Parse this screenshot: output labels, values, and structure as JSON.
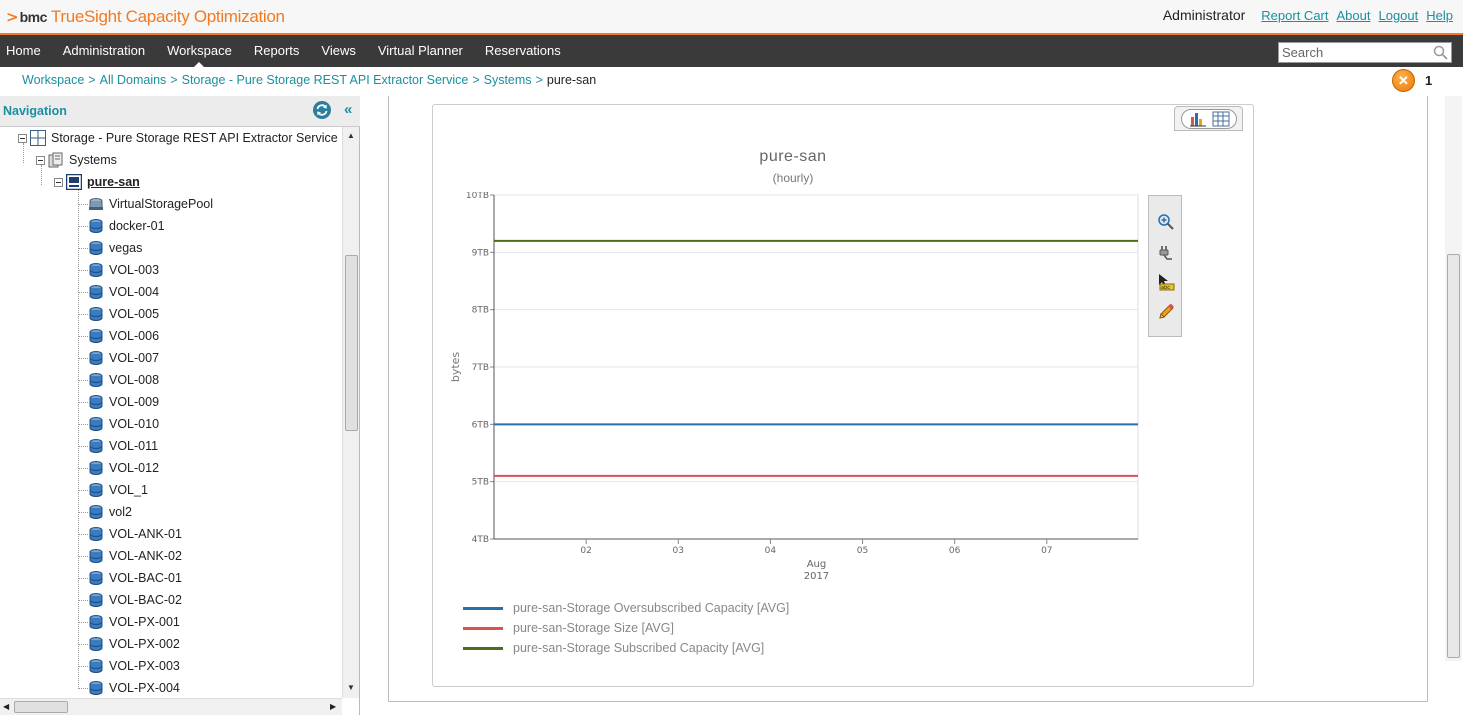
{
  "app": {
    "brand": "bmc",
    "product": "TrueSight Capacity Optimization"
  },
  "header": {
    "user": "Administrator",
    "links": [
      "Report Cart",
      "About",
      "Logout",
      "Help"
    ]
  },
  "menu": {
    "items": [
      "Home",
      "Administration",
      "Workspace",
      "Reports",
      "Views",
      "Virtual Planner",
      "Reservations"
    ],
    "active": "Workspace"
  },
  "search": {
    "placeholder": "Search"
  },
  "breadcrumb": {
    "items": [
      "Workspace",
      "All Domains",
      "Storage - Pure Storage REST API Extractor Service",
      "Systems"
    ],
    "current": "pure-san"
  },
  "alerts": {
    "count": "1"
  },
  "navigation": {
    "title": "Navigation",
    "collapse": "«",
    "domain": "Storage - Pure Storage REST API Extractor Service",
    "folder": "Systems",
    "system": "pure-san",
    "children": [
      "VirtualStoragePool",
      "docker-01",
      "vegas",
      "VOL-003",
      "VOL-004",
      "VOL-005",
      "VOL-006",
      "VOL-007",
      "VOL-008",
      "VOL-009",
      "VOL-010",
      "VOL-011",
      "VOL-012",
      "VOL_1",
      "vol2",
      "VOL-ANK-01",
      "VOL-ANK-02",
      "VOL-BAC-01",
      "VOL-BAC-02",
      "VOL-PX-001",
      "VOL-PX-002",
      "VOL-PX-003",
      "VOL-PX-004"
    ]
  },
  "colors": {
    "accent": "#f27a22",
    "link": "#1a8fa0",
    "navbar": "#3a3a3a"
  },
  "chart_data": {
    "type": "line",
    "title": "pure-san",
    "subtitle": "(hourly)",
    "ylabel": "bytes",
    "xlabel": "",
    "ylim": [
      4,
      10
    ],
    "y_unit": "TB",
    "y_ticks": [
      "4TB",
      "5TB",
      "6TB",
      "7TB",
      "8TB",
      "9TB",
      "10TB"
    ],
    "x_ticks": [
      "02",
      "03",
      "04",
      "05",
      "06",
      "07"
    ],
    "x_tick_values": [
      2,
      3,
      4,
      5,
      6,
      7
    ],
    "x_range": [
      1,
      7.99
    ],
    "x_period_label": [
      "Aug",
      "2017"
    ],
    "x_period_at": 4.5,
    "legend_position": "bottom-left",
    "grid": true,
    "series": [
      {
        "name": "pure-san-Storage Oversubscribed Capacity [AVG]",
        "color": "#2b6fa8",
        "x": [
          1,
          7.99
        ],
        "values": [
          6.0,
          6.0
        ]
      },
      {
        "name": "pure-san-Storage Size [AVG]",
        "color": "#d9534f",
        "x": [
          1,
          7.99
        ],
        "values": [
          5.1,
          5.1
        ]
      },
      {
        "name": "pure-san-Storage Subscribed Capacity [AVG]",
        "color": "#4a6e1a",
        "x": [
          1,
          7.99
        ],
        "values": [
          9.2,
          9.2
        ]
      }
    ]
  }
}
